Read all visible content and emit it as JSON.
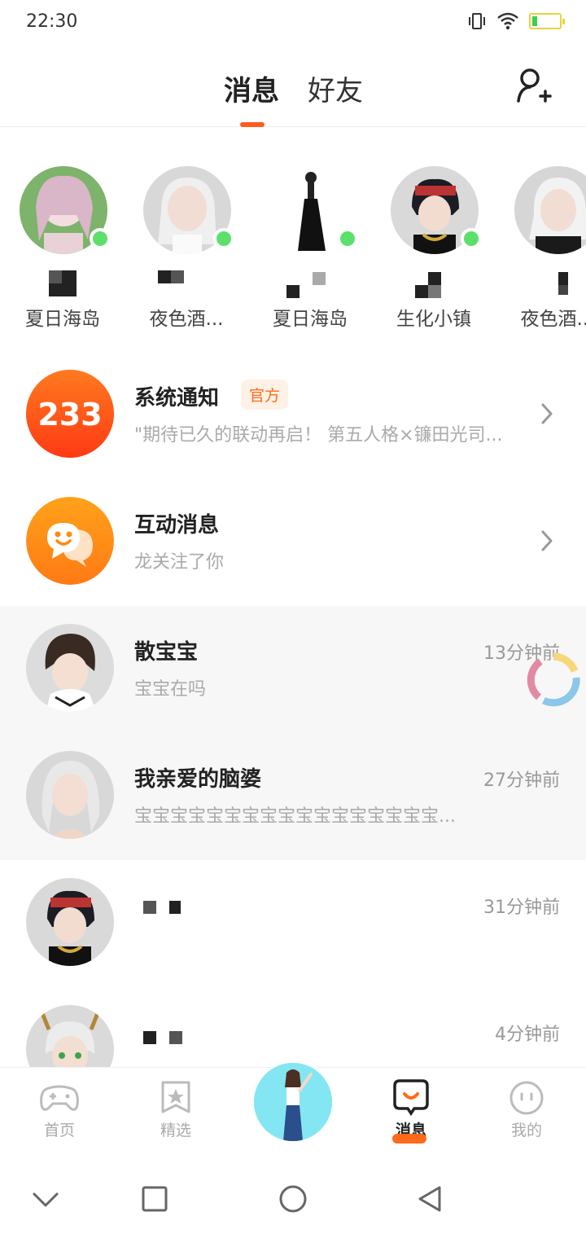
{
  "status_bar": {
    "time": "22:30"
  },
  "header": {
    "tab_messages": "消息",
    "tab_friends": "好友"
  },
  "friends": [
    {
      "game": "夏日海岛",
      "online": true
    },
    {
      "game": "夜色酒...",
      "online": true
    },
    {
      "game": "夏日海岛",
      "online": true
    },
    {
      "game": "生化小镇",
      "online": true
    },
    {
      "game": "夜色酒...",
      "online": false
    }
  ],
  "system_notice": {
    "logo_text": "233",
    "title": "系统通知",
    "badge": "官方",
    "preview": "\"期待已久的联动再启！ 第五人格×镰田光司..."
  },
  "interaction": {
    "title": "互动消息",
    "preview": "龙关注了你"
  },
  "chats": [
    {
      "name": "散宝宝",
      "preview": "宝宝在吗",
      "time": "13分钟前"
    },
    {
      "name": "我亲爱的脑婆",
      "preview": "宝宝宝宝宝宝宝宝宝宝宝宝宝宝宝宝宝...",
      "time": "27分钟前"
    },
    {
      "name": "",
      "preview": "",
      "time": "31分钟前"
    },
    {
      "name": "",
      "preview": "",
      "time": "4分钟前"
    }
  ],
  "bottom_nav": {
    "home": "首页",
    "featured": "精选",
    "messages": "消息",
    "mine": "我的"
  },
  "colors": {
    "accent": "#ff5a1f",
    "online": "#5ce06b",
    "badge_bg": "#fff1e6"
  }
}
